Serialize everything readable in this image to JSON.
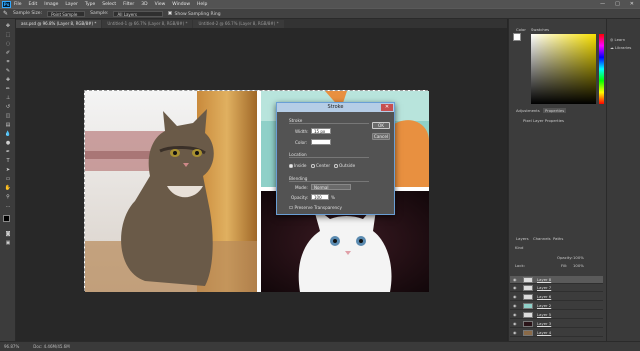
{
  "app": {
    "logo": "Ps"
  },
  "menu": [
    "File",
    "Edit",
    "Image",
    "Layer",
    "Type",
    "Select",
    "Filter",
    "3D",
    "View",
    "Window",
    "Help"
  ],
  "window_controls": [
    "—",
    "□",
    "✕"
  ],
  "options": {
    "sample_size_label": "Sample Size:",
    "sample_size_value": "Point Sample",
    "sample_label": "Sample:",
    "sample_value": "All Layers",
    "ring_label": "Show Sampling Ring"
  },
  "tabs": [
    "ass.psd @ 96.8% (Layer 8, RGB/8#) *",
    "Untitled-1 @ 66.7% (Layer 8, RGB/8#) *",
    "Untitled-2 @ 66.7% (Layer 8, RGB/8#) *"
  ],
  "dialog": {
    "title": "Stroke",
    "close": "✕",
    "stroke_section": "Stroke",
    "width_label": "Width:",
    "width_value": "15 px",
    "color_label": "Color:",
    "location_section": "Location",
    "loc_inside": "Inside",
    "loc_center": "Center",
    "loc_outside": "Outside",
    "blending_section": "Blending",
    "mode_label": "Mode:",
    "mode_value": "Normal",
    "opacity_label": "Opacity:",
    "opacity_value": "100",
    "opacity_unit": "%",
    "preserve": "Preserve Transparency",
    "ok": "OK",
    "cancel": "Cancel"
  },
  "panels": {
    "color_tab": "Color",
    "swatches_tab": "Swatches",
    "adjustments_tab": "Adjustments",
    "properties_tab": "Properties",
    "properties_title": "Pixel Layer Properties",
    "learn": "Learn",
    "libraries": "Libraries",
    "layers_tab": "Layers",
    "channels_tab": "Channels",
    "paths_tab": "Paths",
    "kind_label": "Kind",
    "opacity_label": "Opacity:",
    "opacity_value": "100%",
    "lock_label": "Lock:",
    "fill_label": "Fill:",
    "fill_value": "100%",
    "layers": [
      {
        "name": "Layer 8"
      },
      {
        "name": "Layer 7"
      },
      {
        "name": "Layer 6"
      },
      {
        "name": "Layer 2"
      },
      {
        "name": "Layer 5"
      },
      {
        "name": "Layer 3"
      },
      {
        "name": "Layer 4"
      }
    ]
  },
  "status": {
    "zoom": "96.87%",
    "doc": "Doc: 4.46M/45.6M"
  },
  "colors": {
    "fg": "#000000",
    "bg": "#ffffff",
    "accent": "#31a8ff"
  }
}
